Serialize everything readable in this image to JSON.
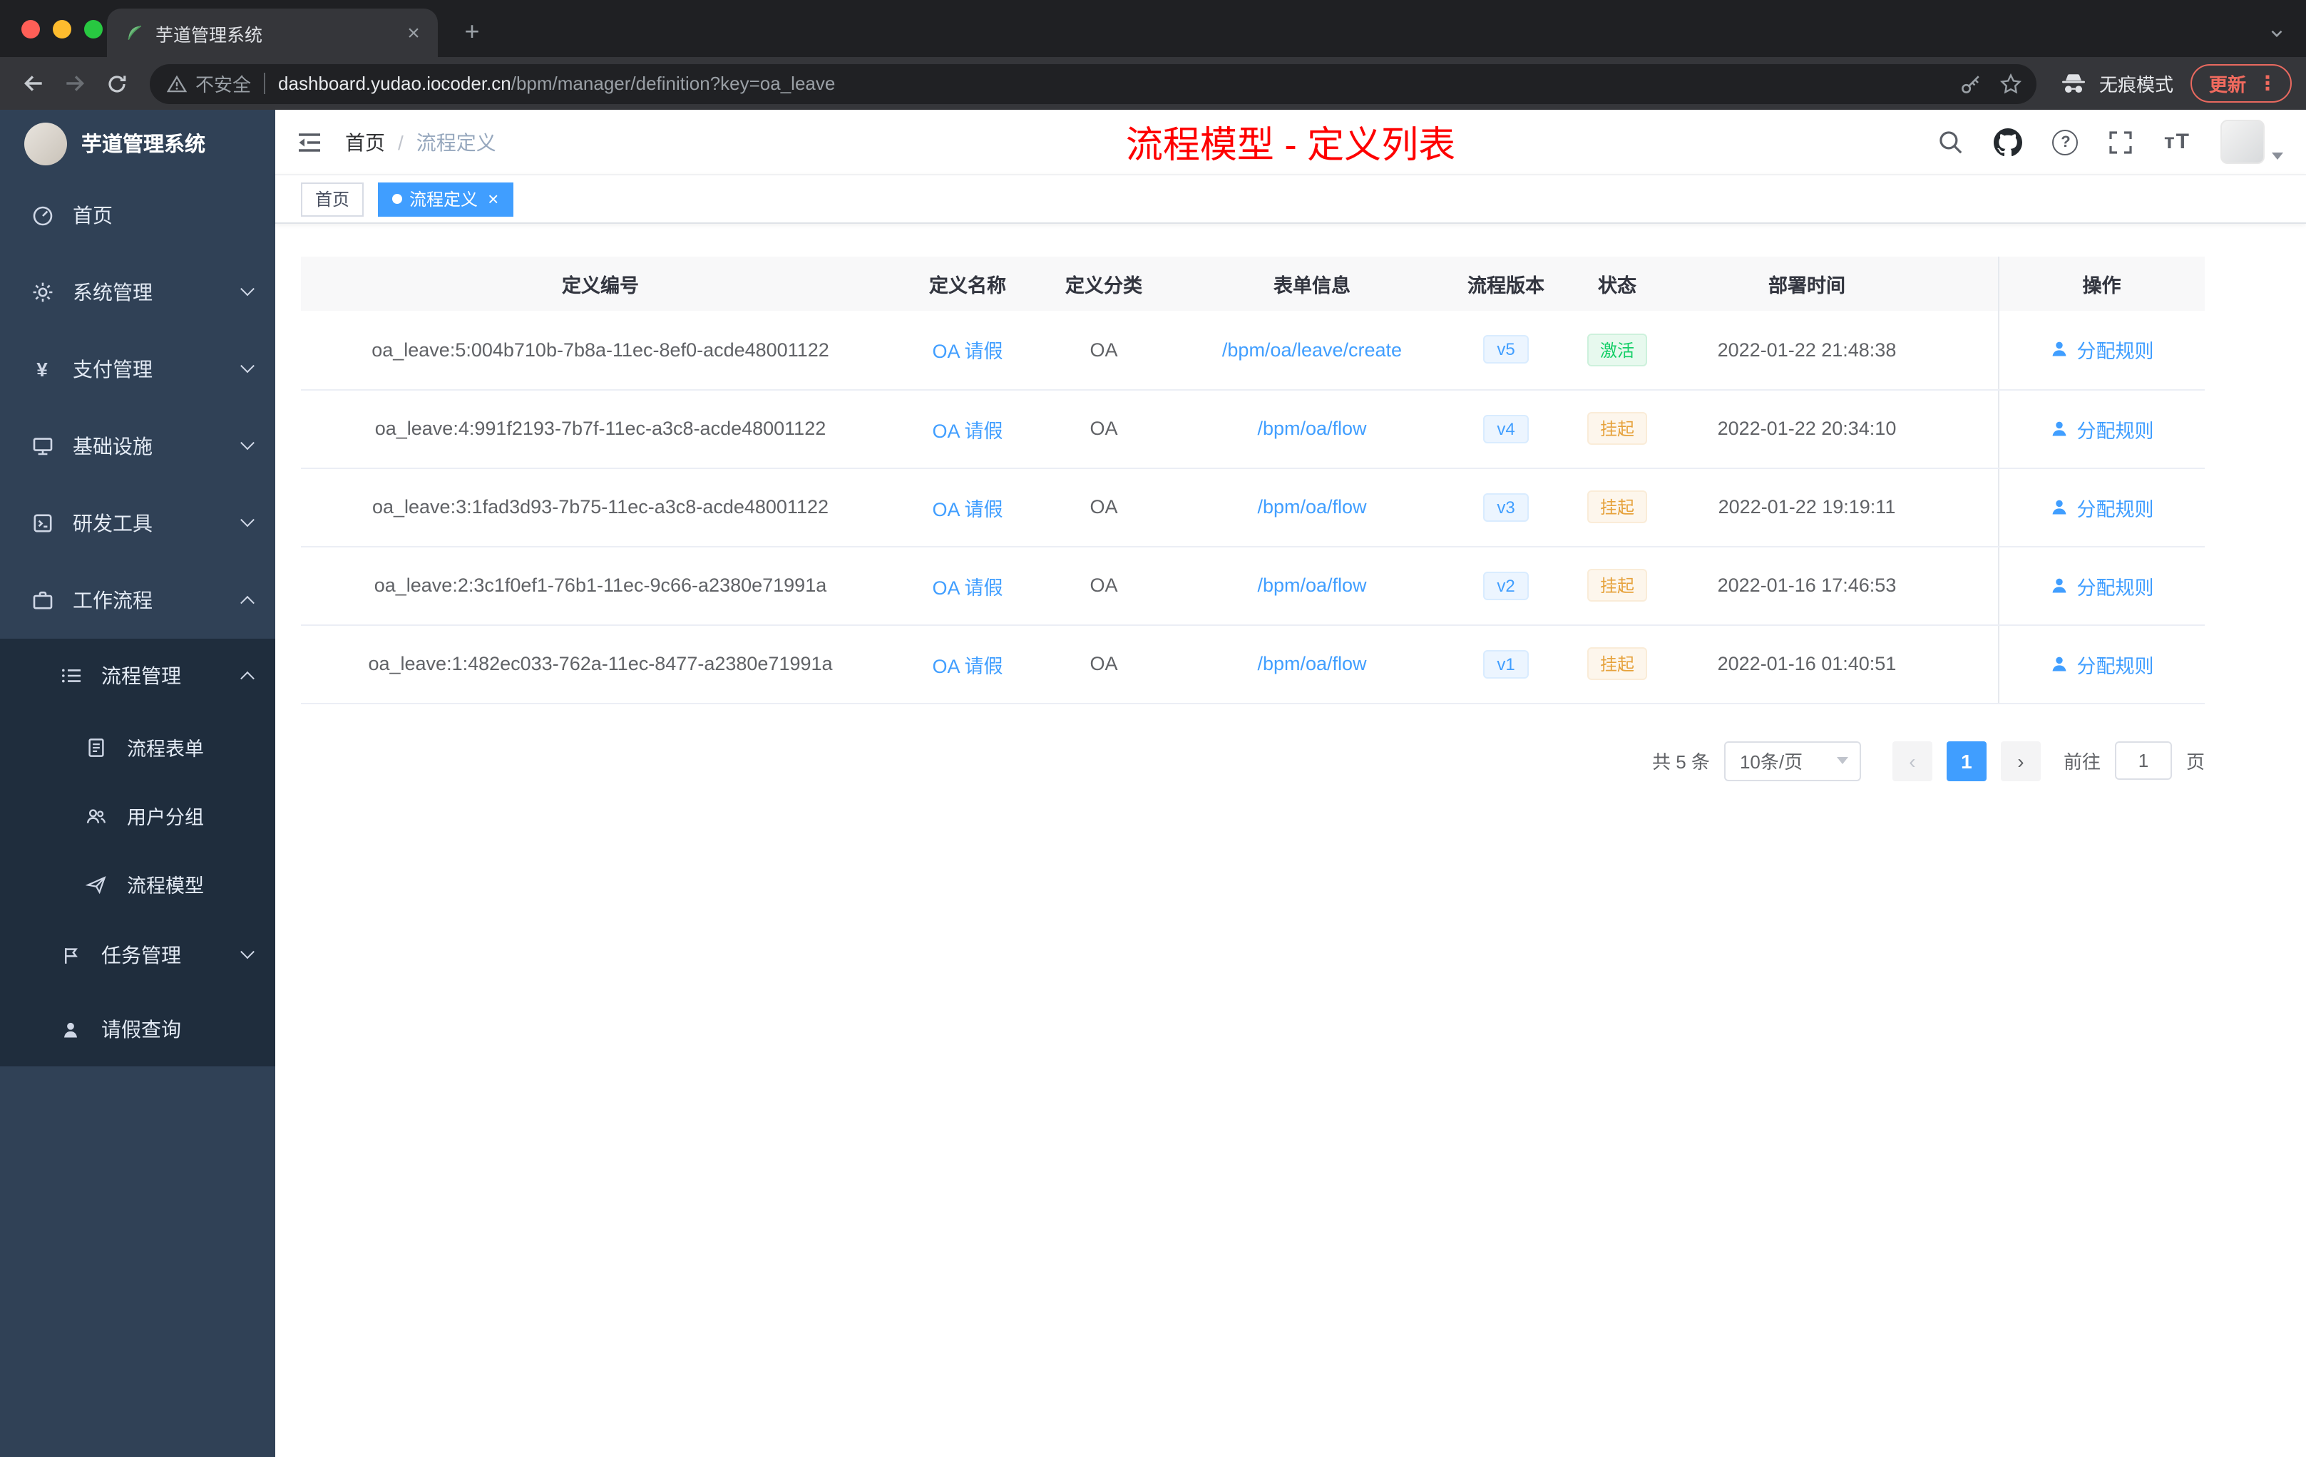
{
  "browser": {
    "tab_title": "芋道管理系统",
    "security_label": "不安全",
    "url_host": "dashboard.yudao.iocoder.cn",
    "url_path": "/bpm/manager/definition?key=oa_leave",
    "incognito_label": "无痕模式",
    "update_label": "更新"
  },
  "icons": {
    "tab_close": "×",
    "new_tab": "+",
    "question_mark": "?",
    "menu_dots": "⋮",
    "font_size": "тT",
    "prev": "‹",
    "next": "›",
    "breadcrumb_separator": "/",
    "tag_close": "×",
    "payment_glyph": "¥"
  },
  "sidebar": {
    "logo_title": "芋道管理系统",
    "menu": [
      {
        "label": "首页",
        "icon": "dashboard-icon"
      },
      {
        "label": "系统管理",
        "icon": "gear-icon"
      },
      {
        "label": "支付管理",
        "icon": "yen-icon"
      },
      {
        "label": "基础设施",
        "icon": "infrastructure-icon"
      },
      {
        "label": "研发工具",
        "icon": "devtools-icon"
      },
      {
        "label": "工作流程",
        "icon": "workflow-icon"
      },
      {
        "label": "流程管理",
        "icon": "process-list-icon"
      },
      {
        "label": "流程表单",
        "icon": "form-icon"
      },
      {
        "label": "用户分组",
        "icon": "user-group-icon"
      },
      {
        "label": "流程模型",
        "icon": "paper-plane-icon"
      },
      {
        "label": "任务管理",
        "icon": "task-flag-icon"
      },
      {
        "label": "请假查询",
        "icon": "person-icon"
      }
    ]
  },
  "header": {
    "breadcrumb_home": "首页",
    "breadcrumb_current": "流程定义",
    "page_title": "流程模型 - 定义列表"
  },
  "tags": {
    "home": "首页",
    "active": "流程定义"
  },
  "table": {
    "columns": [
      "定义编号",
      "定义名称",
      "定义分类",
      "表单信息",
      "流程版本",
      "状态",
      "部署时间",
      "操作"
    ],
    "rows": [
      {
        "id": "oa_leave:5:004b710b-7b8a-11ec-8ef0-acde48001122",
        "name": "OA 请假",
        "category": "OA",
        "form": "/bpm/oa/leave/create",
        "version": "v5",
        "status": "激活",
        "status_type": "success",
        "deploy_time": "2022-01-22 21:48:38",
        "action": "分配规则"
      },
      {
        "id": "oa_leave:4:991f2193-7b7f-11ec-a3c8-acde48001122",
        "name": "OA 请假",
        "category": "OA",
        "form": "/bpm/oa/flow",
        "version": "v4",
        "status": "挂起",
        "status_type": "warning",
        "deploy_time": "2022-01-22 20:34:10",
        "action": "分配规则"
      },
      {
        "id": "oa_leave:3:1fad3d93-7b75-11ec-a3c8-acde48001122",
        "name": "OA 请假",
        "category": "OA",
        "form": "/bpm/oa/flow",
        "version": "v3",
        "status": "挂起",
        "status_type": "warning",
        "deploy_time": "2022-01-22 19:19:11",
        "action": "分配规则"
      },
      {
        "id": "oa_leave:2:3c1f0ef1-76b1-11ec-9c66-a2380e71991a",
        "name": "OA 请假",
        "category": "OA",
        "form": "/bpm/oa/flow",
        "version": "v2",
        "status": "挂起",
        "status_type": "warning",
        "deploy_time": "2022-01-16 17:46:53",
        "action": "分配规则"
      },
      {
        "id": "oa_leave:1:482ec033-762a-11ec-8477-a2380e71991a",
        "name": "OA 请假",
        "category": "OA",
        "form": "/bpm/oa/flow",
        "version": "v1",
        "status": "挂起",
        "status_type": "warning",
        "deploy_time": "2022-01-16 01:40:51",
        "action": "分配规则"
      }
    ]
  },
  "pagination": {
    "total": "共 5 条",
    "page_size": "10条/页",
    "current_page": "1",
    "goto_label": "前往",
    "goto_value": "1",
    "page_label": "页"
  },
  "colors": {
    "accent_blue": "#409eff",
    "title_red": "#fe0000",
    "sidebar_bg": "#304156",
    "submenu_bg": "#1f2d3d",
    "status_success": "#13ce66",
    "status_warning": "#e6a23c"
  }
}
